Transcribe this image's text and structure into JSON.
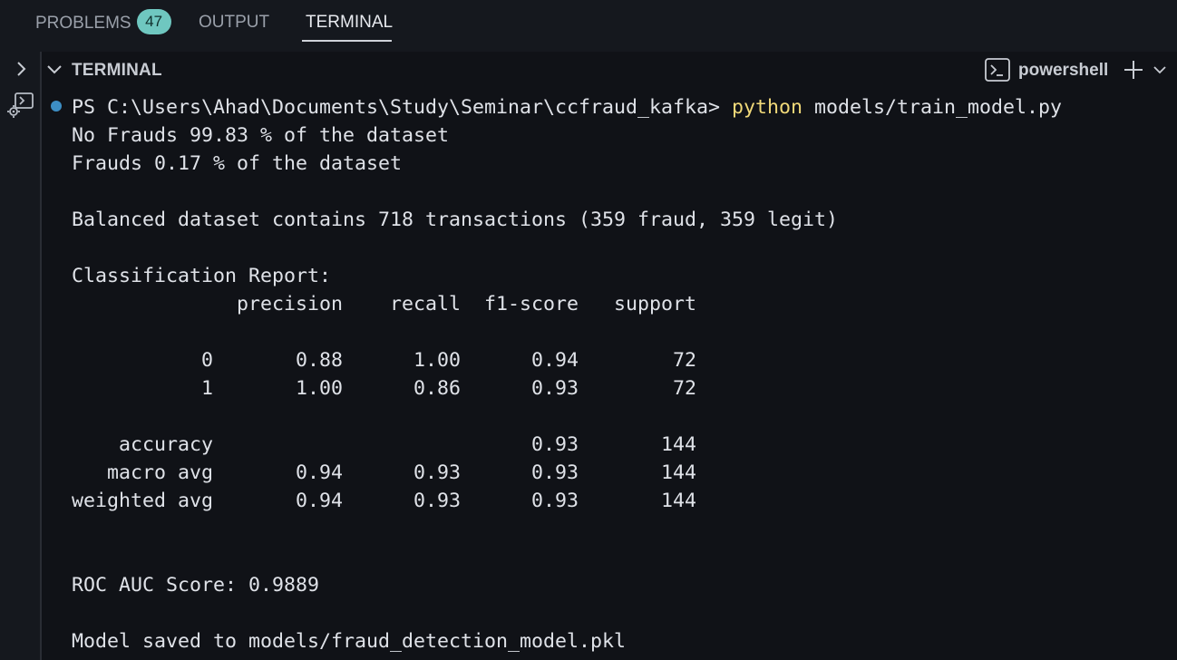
{
  "tabs": {
    "problems": {
      "label": "PROBLEMS",
      "count": "47"
    },
    "output": {
      "label": "OUTPUT"
    },
    "terminal": {
      "label": "TERMINAL"
    }
  },
  "panel": {
    "title": "TERMINAL",
    "shell": "powershell"
  },
  "terminal": {
    "prompt": "PS C:\\Users\\Ahad\\Documents\\Study\\Seminar\\ccfraud_kafka> ",
    "command_name": "python",
    "command_args": " models/train_model.py",
    "lines": [
      "No Frauds 99.83 % of the dataset",
      "Frauds 0.17 % of the dataset",
      "",
      "Balanced dataset contains 718 transactions (359 fraud, 359 legit)",
      "",
      "Classification Report:",
      "              precision    recall  f1-score   support",
      "",
      "           0       0.88      1.00      0.94        72",
      "           1       1.00      0.86      0.93        72",
      "",
      "    accuracy                           0.93       144",
      "   macro avg       0.94      0.93      0.93       144",
      "weighted avg       0.94      0.93      0.93       144",
      "",
      "",
      "ROC AUC Score: 0.9889",
      "",
      "Model saved to models/fraud_detection_model.pkl"
    ]
  },
  "colors": {
    "background": "#101217",
    "text": "#dfe2e8",
    "command_highlight": "#f1d979",
    "status_dot": "#3d8ec4",
    "badge": "#6fc7c0"
  },
  "icons": {
    "collapse": "chevron-down-icon",
    "shell": "terminal-shell-icon",
    "add": "plus-icon",
    "more": "chevron-down-icon",
    "activity": "chevron-right-icon"
  }
}
